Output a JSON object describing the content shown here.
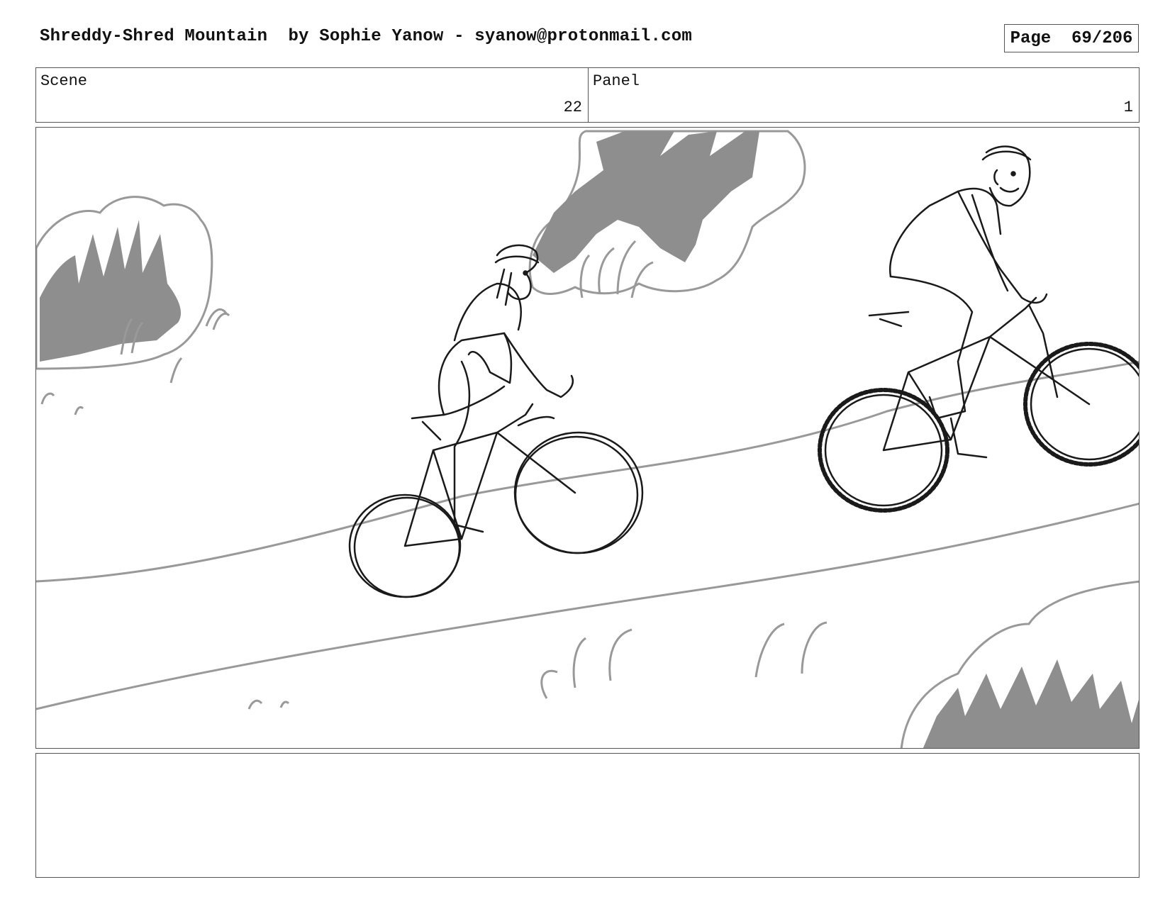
{
  "header": {
    "title": "Shreddy-Shred Mountain  by Sophie Yanow - syanow@protonmail.com",
    "page_label": "Page  69/206"
  },
  "info": {
    "scene_label": "Scene",
    "scene_value": "22",
    "panel_label": "Panel",
    "panel_value": "1"
  },
  "drawing": {
    "subject": "storyboard sketch",
    "ink_color": "#1a1a1a",
    "bush_fill_color": "#8e8e8e",
    "outline_color": "#999999"
  },
  "notes": {
    "text": ""
  }
}
